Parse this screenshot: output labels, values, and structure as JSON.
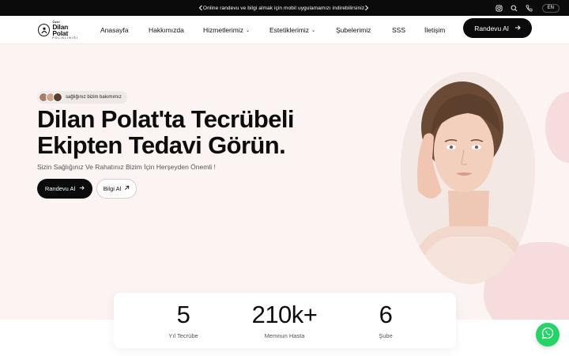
{
  "topbar": {
    "message": "Online randevu ve bilgi almak için mobil uygulamamızı indirebilirsiniz.",
    "icons": [
      "chevron-left-icon",
      "chevron-right-icon",
      "instagram-icon",
      "search-icon",
      "phone-icon"
    ],
    "lang": "EN"
  },
  "logo": {
    "line1": "Özel",
    "line2": "Dilan Polat",
    "line3": "POLİKLİNİĞİ"
  },
  "nav": {
    "items": [
      {
        "label": "Anasayfa"
      },
      {
        "label": "Hakkımızda"
      },
      {
        "label": "Hizmetlerimiz"
      },
      {
        "label": "Estetiklerimiz"
      },
      {
        "label": "Şubelerimiz"
      },
      {
        "label": "SSS"
      },
      {
        "label": "İletişim"
      }
    ],
    "cta": "Randevu Al"
  },
  "hero": {
    "badge": "sağlığınız bizim bakımımız",
    "headline_line1": "Dilan Polat'ta Tecrübeli",
    "headline_line2": "Ekipten Tedavi Görün.",
    "subtext": "Sizin Sağlığınız Ve Rahatınız Bizim İçin Herşeyden Önemli !",
    "primary_button": "Randevu Al",
    "secondary_button": "Bilgi Al"
  },
  "stats": [
    {
      "value": "5",
      "label": "Yıl Tecrübe"
    },
    {
      "value": "210k+",
      "label": "Memnun Hasta"
    },
    {
      "value": "6",
      "label": "Şube"
    }
  ],
  "colors": {
    "dark": "#0b0b0b",
    "hero_bg": "#fcf3f3",
    "blob": "#f6dcdc",
    "whatsapp": "#25d366"
  }
}
